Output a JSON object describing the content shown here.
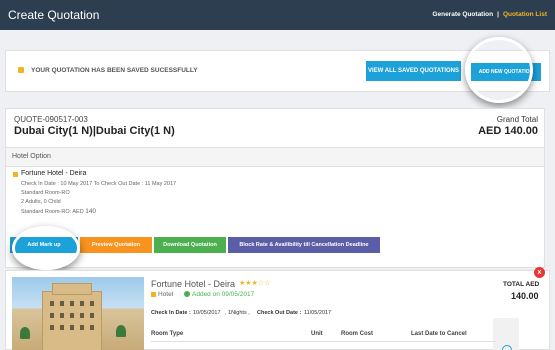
{
  "topbar": {
    "title": "Create Quotation",
    "nav_generate": "Generate Quotation",
    "nav_separator": "|",
    "nav_list": "Quotation List"
  },
  "notice": {
    "message": "YOUR QUOTATION HAS BEEN SAVED SUCESSFULLY",
    "view_all_label": "VIEW ALL SAVED QUOTATIONS",
    "add_new_label": "ADD NEW QUOTATION"
  },
  "quote": {
    "number": "QUOTE-090517-003",
    "route": "Dubai City(1 N)|Dubai City(1 N)",
    "grand_total_label": "Grand Total",
    "grand_total_value": "AED 140.00",
    "hotel_option_label": "Hotel Option",
    "hotel": {
      "name": "Fortune Hotel - Deira",
      "dates": "Check In Date : 10 May 2017 To Check Out Date : 11 May 2017",
      "room": "Standard Room-RO",
      "guests": "2 Adults, 0 Child",
      "room_price_label": "Standard Room-RO: AED",
      "room_price_value": "140"
    },
    "actions": {
      "add_markup": "Add Mark up",
      "preview": "Preview Quotation",
      "download": "Download Quotation",
      "block_rate": "Block Rate & Availibility till Cancellation Deadline"
    }
  },
  "hotel_detail": {
    "name": "Fortune Hotel - Deira",
    "stars": "★★★☆☆",
    "type": "Hotel",
    "added": "Added on 09/05/2017",
    "checkin_label": "Check In Date :",
    "checkin_value": "10/05/2017",
    "nights": ", 1Nights ,",
    "checkout_label": "Check Out Date :",
    "checkout_value": "11/05/2017",
    "total_label": "TOTAL AED",
    "total_value": "140.00",
    "close": "x",
    "table_headers": [
      "Room Type",
      "Unit",
      "Room Cost",
      "Last Date to Cancel"
    ]
  },
  "colors": {
    "topbar": "#2c3e50",
    "accent_blue": "#1ca1d8",
    "orange": "#f7931e",
    "green": "#4caf50",
    "purple": "#5b5ea6",
    "gold": "#f2b521",
    "red": "#e53935"
  }
}
